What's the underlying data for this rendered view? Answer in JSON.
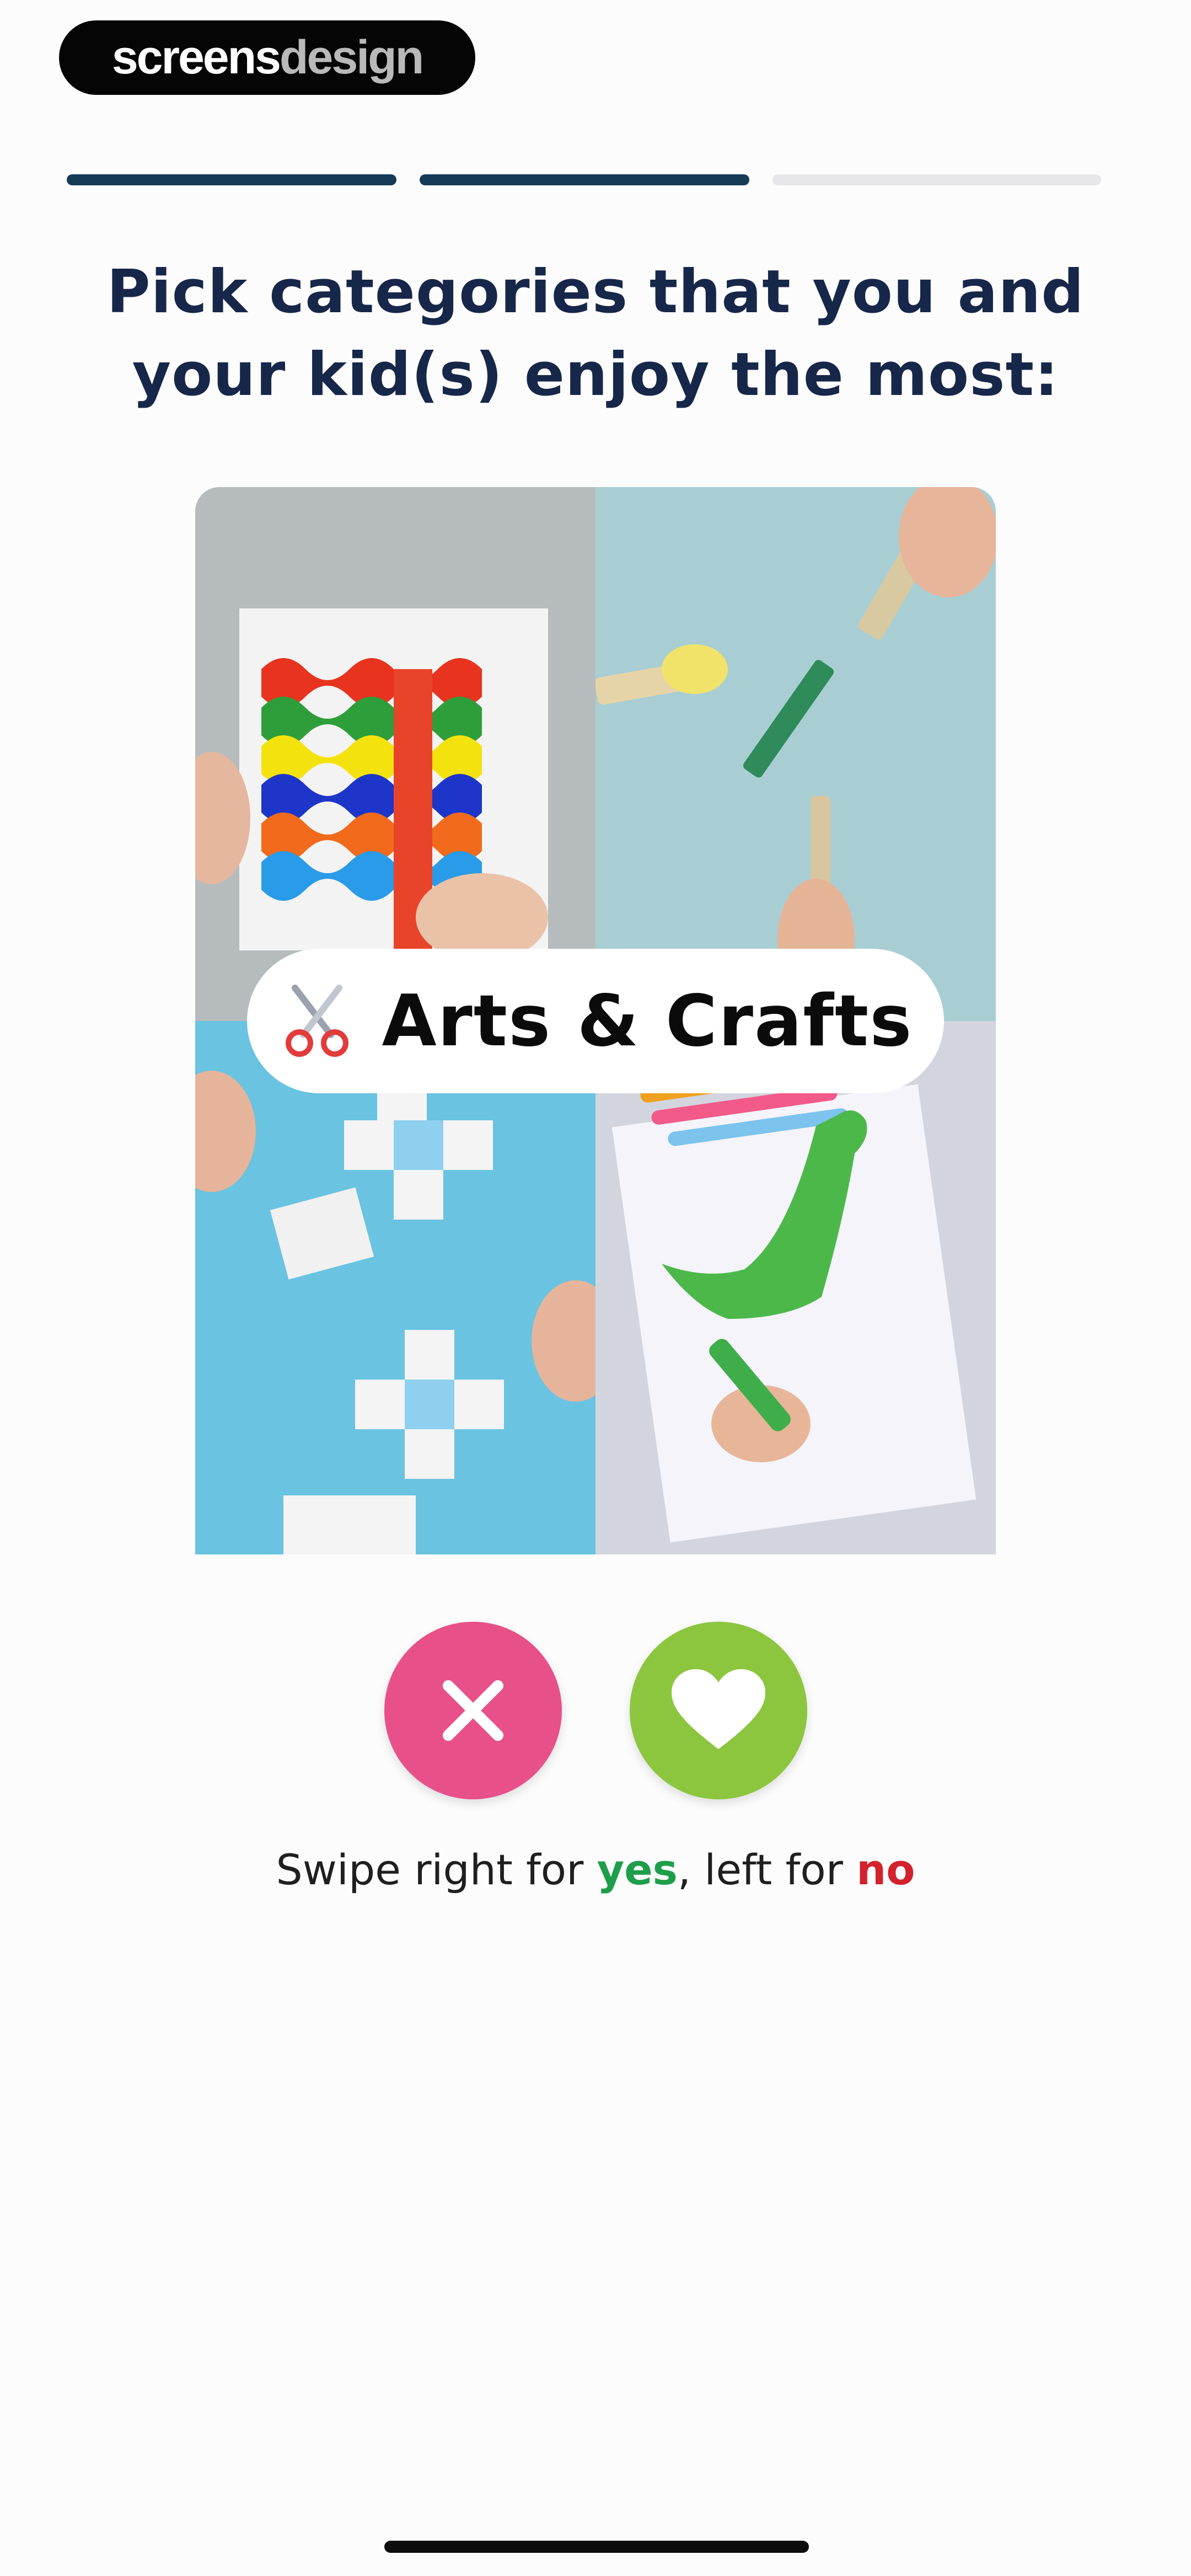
{
  "brand": {
    "part1": "screens",
    "part2": "design"
  },
  "progress": {
    "steps_total": 3,
    "steps_completed": 2
  },
  "title": "Pick categories that you and your kid(s) enjoy the most:",
  "card": {
    "category": "Arts & Crafts",
    "icon": "scissors-icon"
  },
  "actions": {
    "no_icon": "close-icon",
    "yes_icon": "heart-icon"
  },
  "hint": {
    "prefix": "Swipe right for ",
    "yes": "yes",
    "middle": ", left for ",
    "no": "no"
  },
  "colors": {
    "title": "#17274a",
    "progress_active": "#163b57",
    "progress_inactive": "#e7e7ea",
    "no_button": "#e8508a",
    "yes_button": "#8cc63f",
    "yes_text": "#1e9e4a",
    "no_text": "#d3222e"
  }
}
